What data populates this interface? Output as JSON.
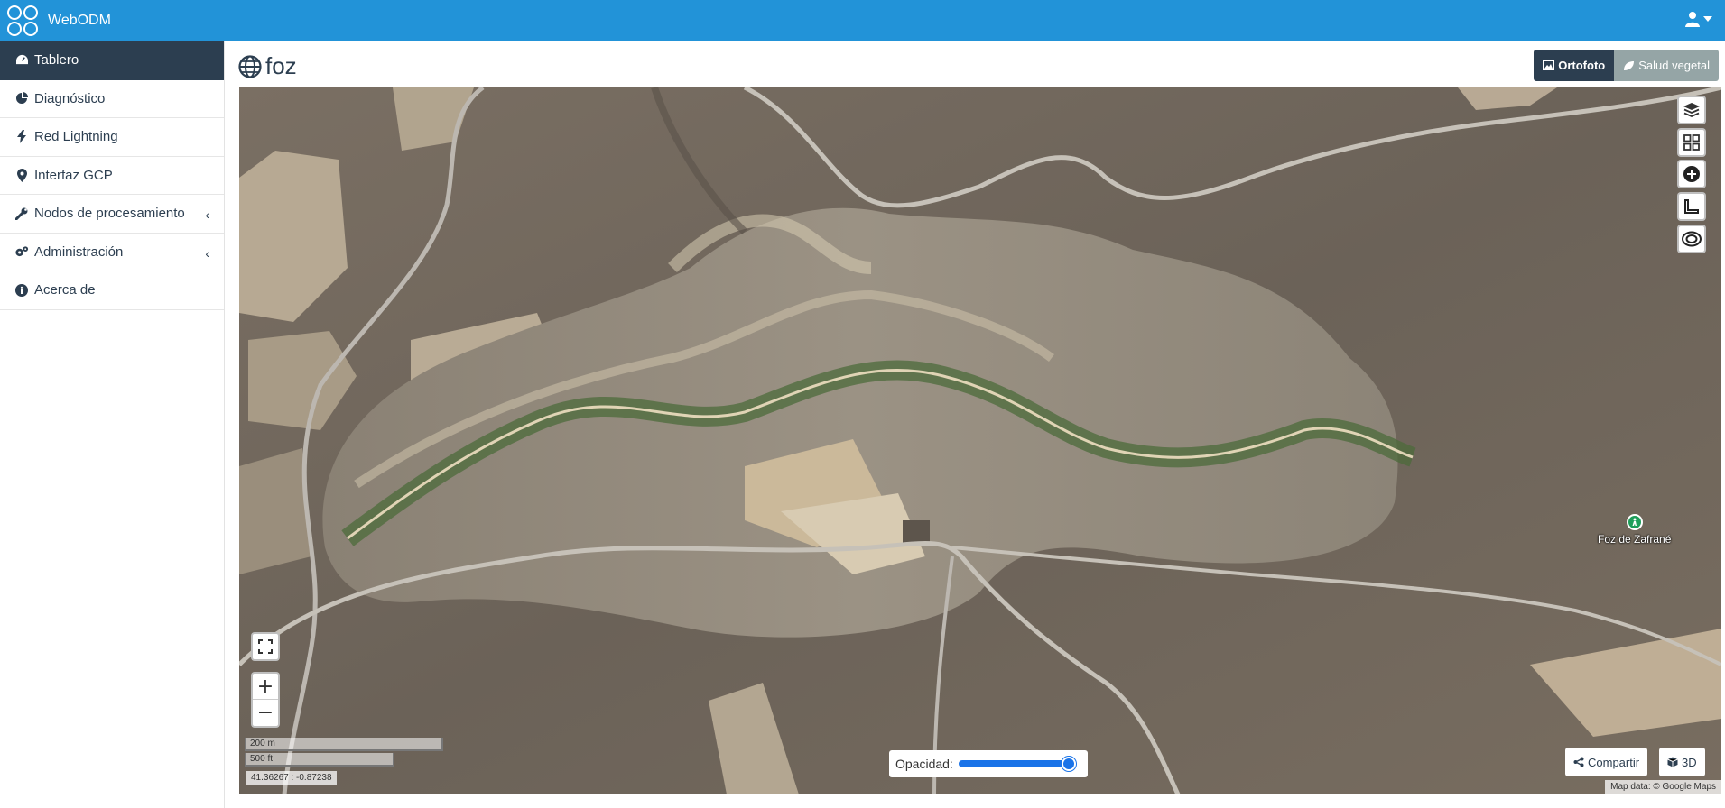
{
  "app": {
    "name": "WebODM"
  },
  "colors": {
    "topbar": "#2293d8",
    "sidebar_active": "#2c3e50",
    "accent": "#1a73e8"
  },
  "sidebar": {
    "items": [
      {
        "label": "Tablero",
        "icon": "dashboard-icon",
        "active": true
      },
      {
        "label": "Diagnóstico",
        "icon": "pie-chart-icon"
      },
      {
        "label": "Red Lightning",
        "icon": "bolt-icon"
      },
      {
        "label": "Interfaz GCP",
        "icon": "map-marker-icon"
      },
      {
        "label": "Nodos de procesamiento",
        "icon": "wrench-icon",
        "arrow": "‹"
      },
      {
        "label": "Administración",
        "icon": "cogs-icon",
        "arrow": "‹"
      },
      {
        "label": "Acerca de",
        "icon": "info-icon"
      }
    ]
  },
  "main": {
    "title": "foz",
    "view_toggle": {
      "orthophoto": "Ortofoto",
      "plant_health": "Salud vegetal"
    }
  },
  "map": {
    "scale_metric": "200 m",
    "scale_imperial": "500 ft",
    "coordinates": "41.36267 : -0.87238",
    "opacity_label": "Opacidad:",
    "opacity_value": 1.0,
    "share_label": "Compartir",
    "view3d_label": "3D",
    "attribution": "Map data: © Google Maps",
    "poi_label": "Foz de Zafrané",
    "zoom_in": "+",
    "zoom_out": "−"
  }
}
